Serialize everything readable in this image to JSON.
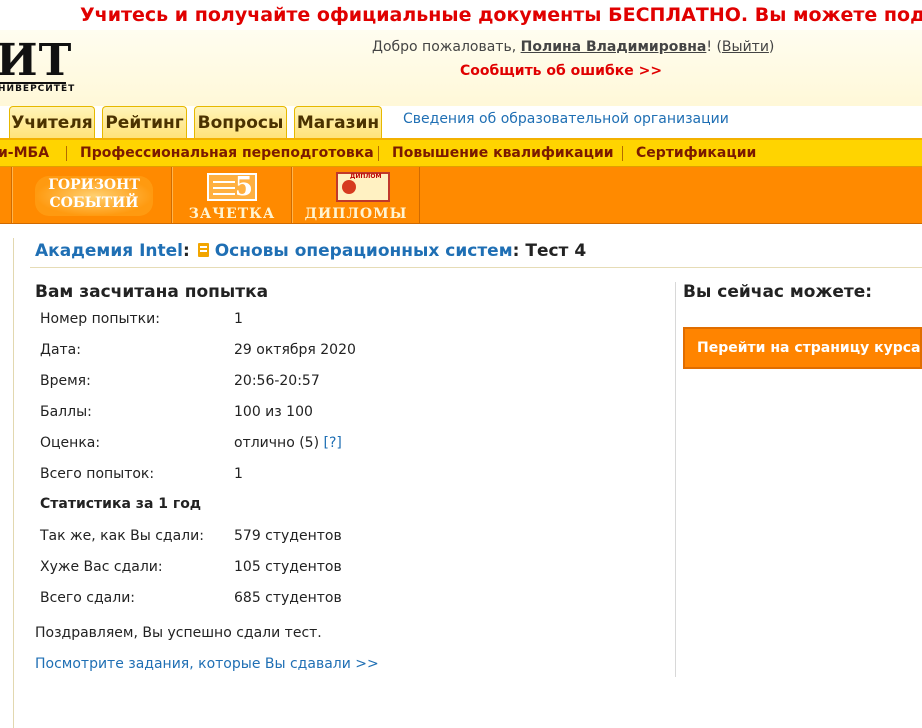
{
  "promo": "Учитесь и получайте официальные документы БЕСПЛАТНО. Вы можете поддержать",
  "logo": {
    "text": "ИТ",
    "subtitle": "НИВЕРСИТЕТ"
  },
  "header": {
    "welcome_prefix": "Добро пожаловать, ",
    "user_name": "Полина Владимировна",
    "welcome_after": "! (",
    "logout": "Выйти",
    "close_paren": ")",
    "report_error": "Сообщить об ошибке >>"
  },
  "tabs": [
    "Учителя",
    "Рейтинг",
    "Вопросы",
    "Магазин"
  ],
  "org_link": "Сведения об образовательной организации",
  "menu": [
    "и-МБА",
    "Профессиональная переподготовка",
    "Повышение квалификации",
    "Сертификации"
  ],
  "banners": {
    "horizon_line1": "ГОРИЗОНТ",
    "horizon_line2": "СОБЫТИЙ",
    "zachetka": "ЗАЧЕТКА",
    "zachetka_num": "5",
    "diplomy": "ДИПЛОМЫ",
    "diplom_small": "ДИПЛОМ"
  },
  "breadcrumb": {
    "academy": "Академия Intel",
    "sep1": ":",
    "course": "Основы операционных систем",
    "sep2": ":",
    "test": "Тест 4"
  },
  "result": {
    "title": "Вам засчитана попытка",
    "rows": [
      {
        "label": "Номер попытки:",
        "value": "1"
      },
      {
        "label": "Дата:",
        "value": "29 октября 2020"
      },
      {
        "label": "Время:",
        "value": "20:56-20:57"
      },
      {
        "label": "Баллы:",
        "value": "100 из 100"
      },
      {
        "label": "Оценка:",
        "value": "отлично (5)",
        "help": "[?]"
      },
      {
        "label": "Всего попыток:",
        "value": "1"
      }
    ],
    "stats_title": "Статистика за 1 год",
    "stats": [
      {
        "label": "Так же, как Вы сдали:",
        "value": "579 студентов"
      },
      {
        "label": "Хуже Вас сдали:",
        "value": "105 студентов"
      },
      {
        "label": "Всего сдали:",
        "value": "685 студентов"
      }
    ],
    "congrats": "Поздравляем, Вы успешно сдали тест.",
    "view_link": "Посмотрите задания, которые Вы сдавали >>"
  },
  "sidebar": {
    "title": "Вы сейчас можете:",
    "button": "Перейти на страницу курса"
  },
  "colors": {
    "accent_orange": "#ff8a00",
    "menu_yellow": "#ffd400",
    "link_blue": "#1f6fb4",
    "alert_red": "#e00000"
  }
}
